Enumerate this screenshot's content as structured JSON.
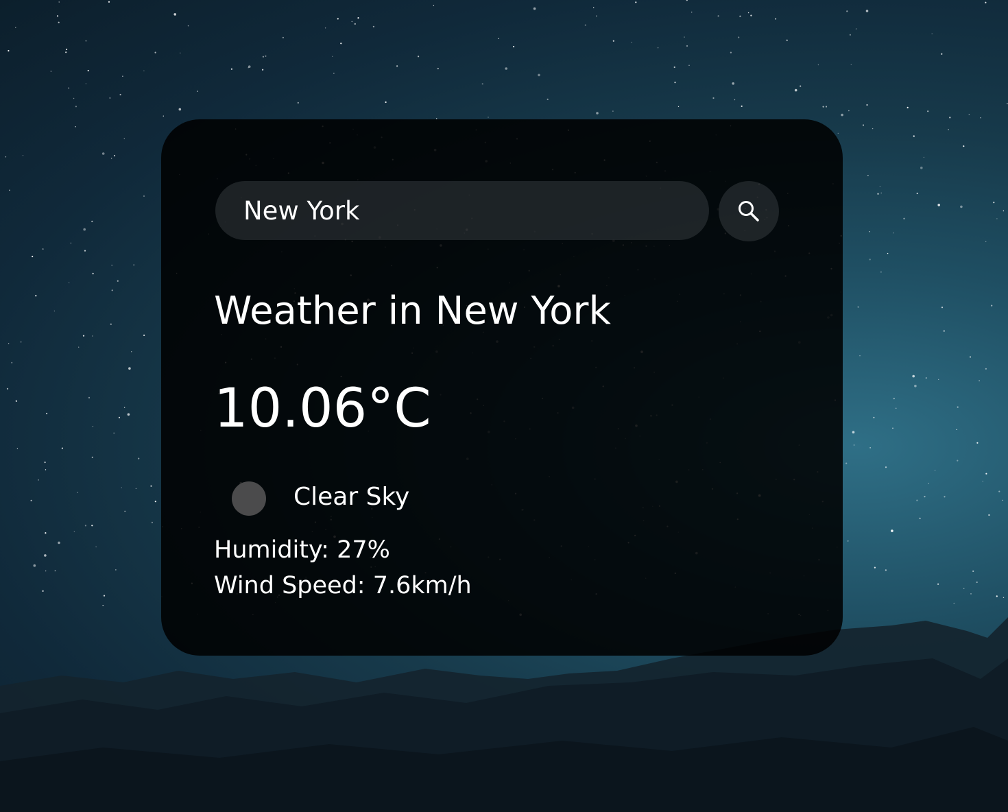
{
  "search": {
    "value": "New York",
    "placeholder": "",
    "button_icon": "search-icon"
  },
  "weather": {
    "title": "Weather in New York",
    "temperature": "10.06°C",
    "condition_icon": "weather-condition-icon",
    "condition": "Clear Sky",
    "humidity": "Humidity: 27%",
    "wind_speed": "Wind Speed: 7.6km/h"
  },
  "colors": {
    "card_background": "#000000",
    "text": "#ffffff",
    "input_background": "#2a2f33",
    "sky_accent": "#2f6f86"
  }
}
